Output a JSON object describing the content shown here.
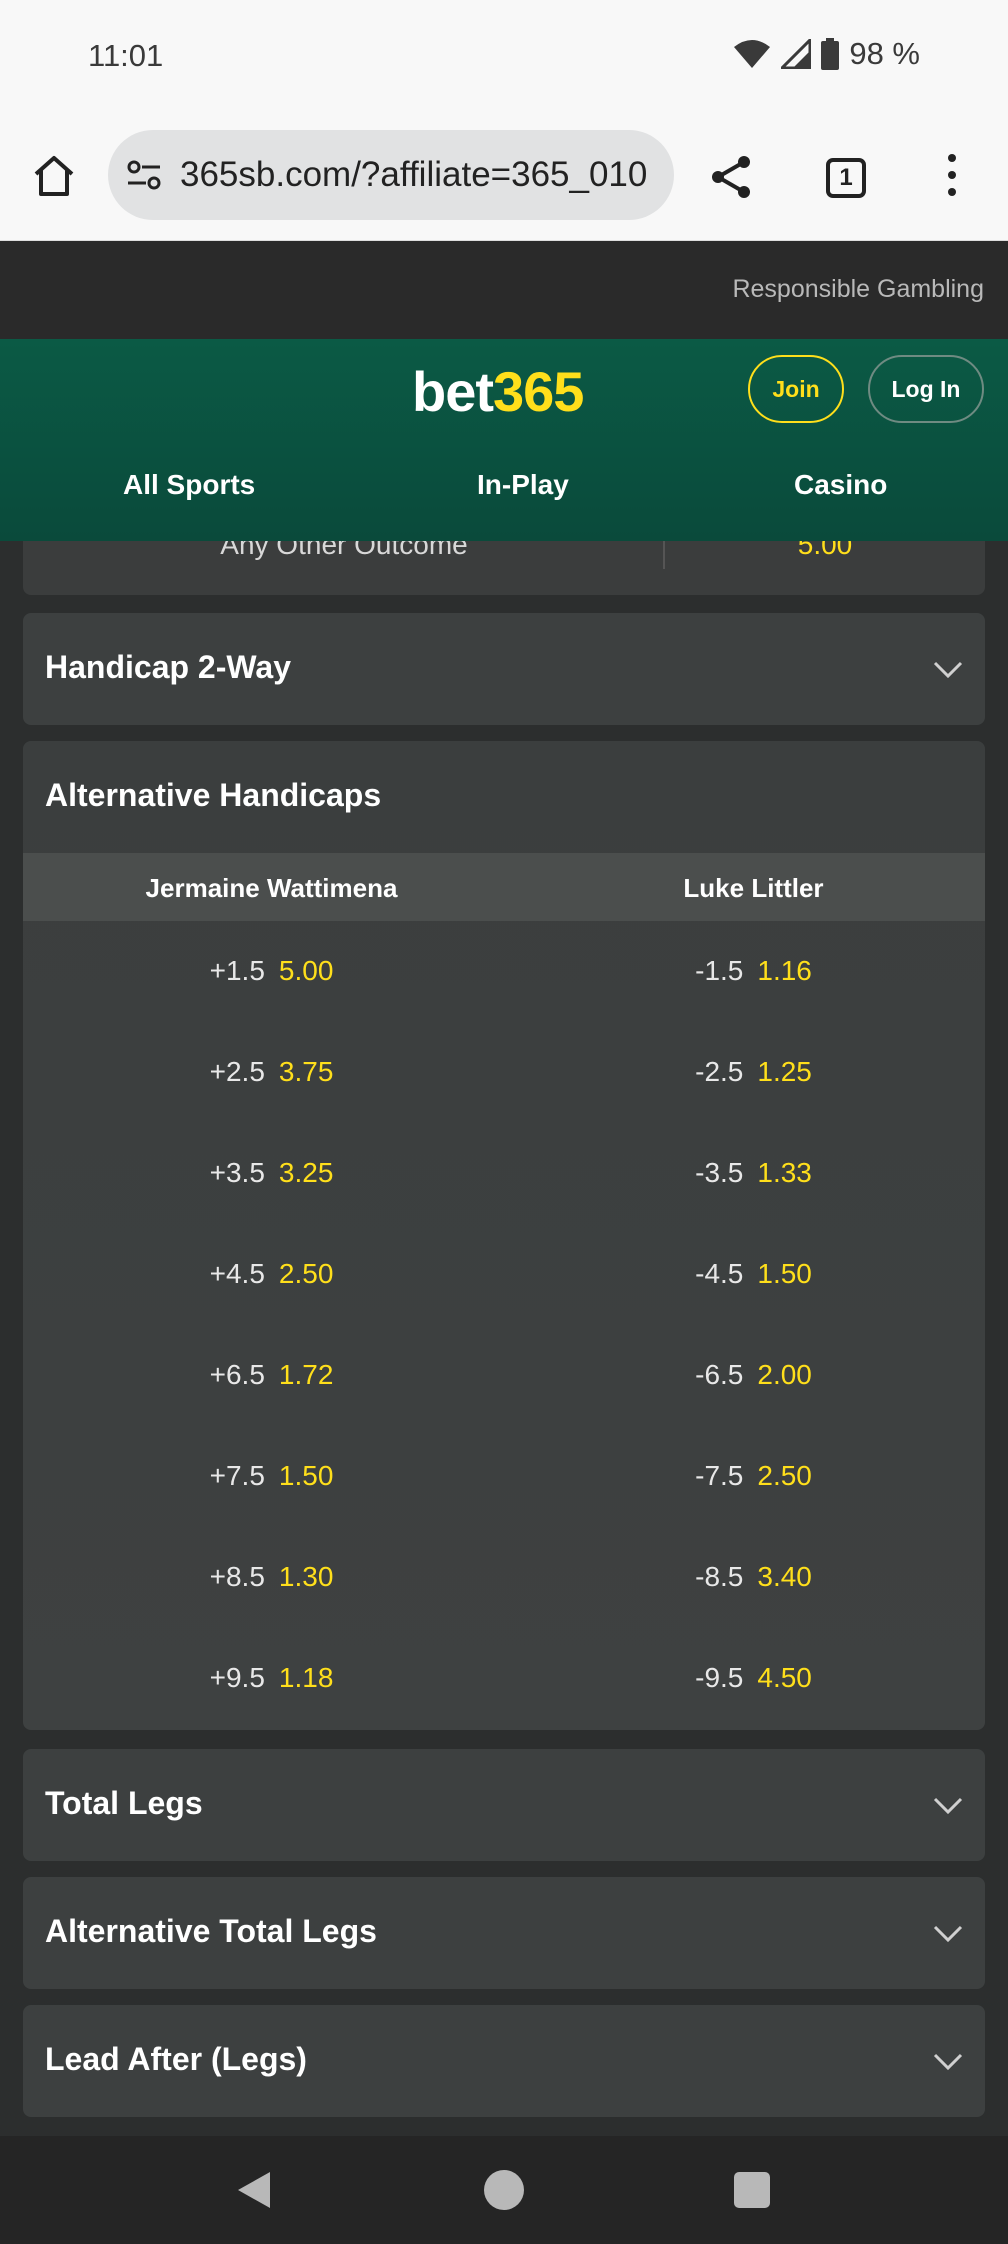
{
  "status_bar": {
    "time": "11:01",
    "battery": "98 %",
    "icons": [
      "wifi-icon",
      "signal-icon",
      "battery-icon"
    ]
  },
  "browser": {
    "url": "365sb.com/?affiliate=365_010",
    "tab_count": "1",
    "icons": [
      "home-icon",
      "site-settings-icon",
      "share-icon",
      "tabs-icon",
      "more-vert-icon"
    ]
  },
  "top_strip": {
    "responsible_gambling": "Responsible Gambling"
  },
  "header": {
    "logo_part1": "bet",
    "logo_part2": "365",
    "join_label": "Join",
    "login_label": "Log In",
    "nav": [
      "All Sports",
      "In-Play",
      "Casino"
    ]
  },
  "partial_row": {
    "label": "Any Other Outcome",
    "odds": "5.00"
  },
  "markets": {
    "handicap_2way": "Handicap 2-Way",
    "alternative_handicaps": {
      "title": "Alternative Handicaps",
      "player1": "Jermaine Wattimena",
      "player2": "Luke Littler",
      "rows": [
        {
          "h1": "+1.5",
          "o1": "5.00",
          "h2": "-1.5",
          "o2": "1.16"
        },
        {
          "h1": "+2.5",
          "o1": "3.75",
          "h2": "-2.5",
          "o2": "1.25"
        },
        {
          "h1": "+3.5",
          "o1": "3.25",
          "h2": "-3.5",
          "o2": "1.33"
        },
        {
          "h1": "+4.5",
          "o1": "2.50",
          "h2": "-4.5",
          "o2": "1.50"
        },
        {
          "h1": "+6.5",
          "o1": "1.72",
          "h2": "-6.5",
          "o2": "2.00"
        },
        {
          "h1": "+7.5",
          "o1": "1.50",
          "h2": "-7.5",
          "o2": "2.50"
        },
        {
          "h1": "+8.5",
          "o1": "1.30",
          "h2": "-8.5",
          "o2": "3.40"
        },
        {
          "h1": "+9.5",
          "o1": "1.18",
          "h2": "-9.5",
          "o2": "4.50"
        }
      ]
    },
    "total_legs": "Total Legs",
    "alternative_total_legs": "Alternative Total Legs",
    "lead_after_legs": "Lead After (Legs)"
  },
  "colors": {
    "brand_green": "#0b5a45",
    "accent_yellow": "#ffdf1b"
  }
}
